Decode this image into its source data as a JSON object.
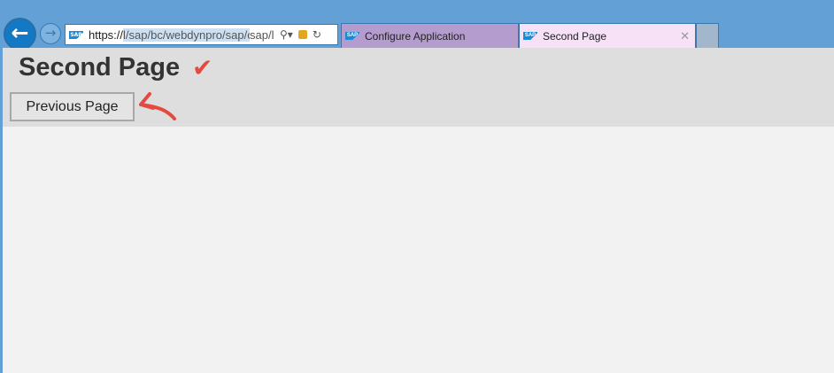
{
  "browser": {
    "address": {
      "prefix": "https://",
      "selected": "l/sap/bc/webdynpro/sap/cc",
      "suffix": "sap/l"
    },
    "tabs": [
      {
        "label": "Configure Application",
        "active": false
      },
      {
        "label": "Second Page",
        "active": true
      }
    ],
    "favicon_text": "SAP"
  },
  "page": {
    "title": "Second Page",
    "previous_button": "Previous Page"
  },
  "colors": {
    "annotation": "#e54a3f",
    "frame": "#62a0d6"
  }
}
